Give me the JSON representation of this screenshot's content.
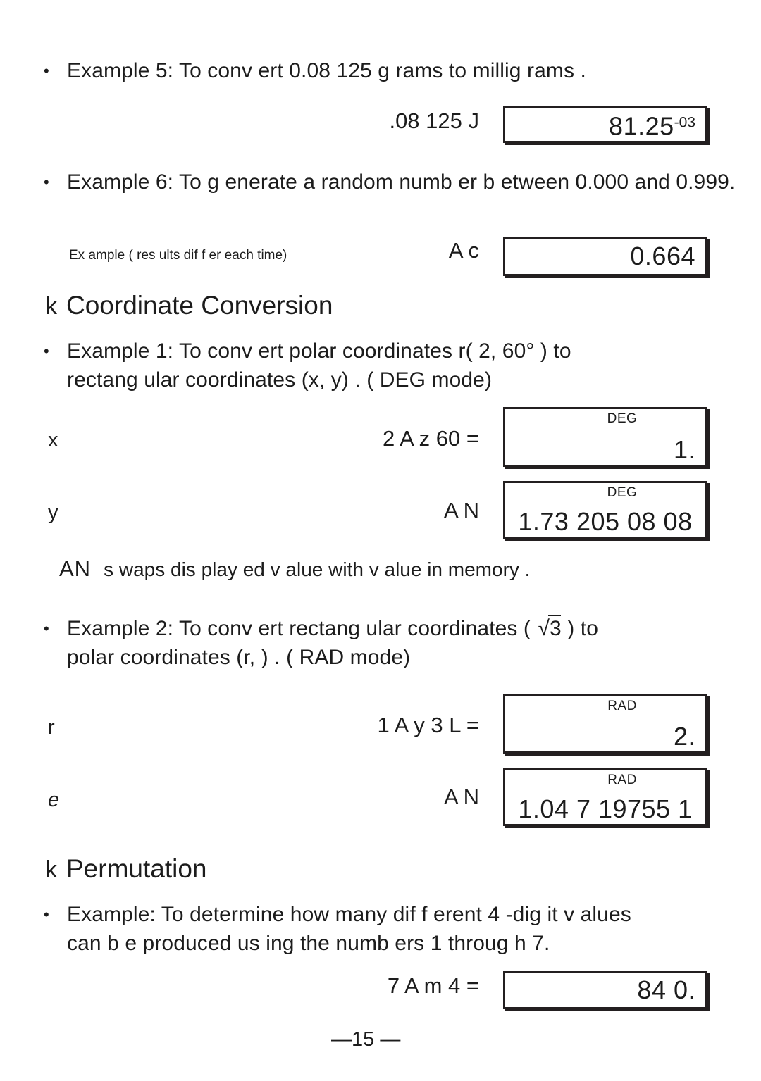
{
  "document": {
    "page_number": "—15 —",
    "kind": "calculator-manual-page"
  },
  "examples": [
    {
      "id": "example-5",
      "bullet": "•",
      "text": "Example 5:  To conv ert 0.08 125 g rams  to millig rams .",
      "keystrokes": ".08 125 J",
      "display": {
        "value": "81.25",
        "exponent": "-03",
        "mode": ""
      }
    },
    {
      "id": "example-6",
      "bullet": "•",
      "text": "Example 6:  To g enerate a random numb er b etween 0.000 and 0.999.",
      "note": "Ex ample ( res ults  dif f er each time)",
      "keystrokes": "A  c",
      "display": {
        "value": "0.664",
        "exponent": "",
        "mode": ""
      }
    }
  ],
  "sections": [
    {
      "id": "coordinate-conversion",
      "glyph": "k",
      "title": "Coordinate Conversion",
      "examples": [
        {
          "id": "coord-example-1",
          "bullet": "•",
          "line1": "Example 1:  To conv ert polar coordinates r(  2,       60° )  to",
          "line2": "rectang ular coordinates  (x, y) . ( DEG mode)"
        },
        {
          "id": "coord-example-2",
          "bullet": "•",
          "line1_prefix": "Example 2:  To conv ert rectang ular coordinates  ( ",
          "line1_radical": "3",
          "line1_suffix": " )  to",
          "line2": "polar coordinates  (r,  ) . ( RAD mode)"
        }
      ],
      "memory_note": {
        "keys": "AN",
        "text": "s waps  dis play ed v alue with v alue in memory ."
      },
      "rows": [
        {
          "label": "x",
          "italic": false,
          "keystrokes": "2 A  z   60 =",
          "display": {
            "mode": "DEG",
            "value": "1.",
            "align": "right"
          }
        },
        {
          "label": "y",
          "italic": false,
          "keystrokes": "A  N",
          "display": {
            "mode": "DEG",
            "value": "1.73 205 08 08",
            "align": "center"
          }
        },
        {
          "label": "r",
          "italic": false,
          "keystrokes": "1 A  y   3 L  =",
          "display": {
            "mode": "RAD",
            "value": "2.",
            "align": "right"
          }
        },
        {
          "label": "e",
          "italic": true,
          "keystrokes": "A  N",
          "display": {
            "mode": "RAD",
            "value": "1.04 7 19755 1",
            "align": "center"
          }
        }
      ]
    },
    {
      "id": "permutation",
      "glyph": "k",
      "title": "Permutation",
      "example": {
        "bullet": "•",
        "line1": "Example:  To determine how many  dif f erent 4 -dig it v alues",
        "line2": "can b e produced us ing  the numb ers  1 throug h 7."
      },
      "row": {
        "keystrokes": "7 A  m  4 =",
        "display": {
          "mode": "",
          "value": "84 0.",
          "align": "right"
        }
      }
    }
  ],
  "colors": {
    "ink": "#1c1c1c",
    "box_border": "#231f20",
    "page_background": "#ffffff"
  }
}
